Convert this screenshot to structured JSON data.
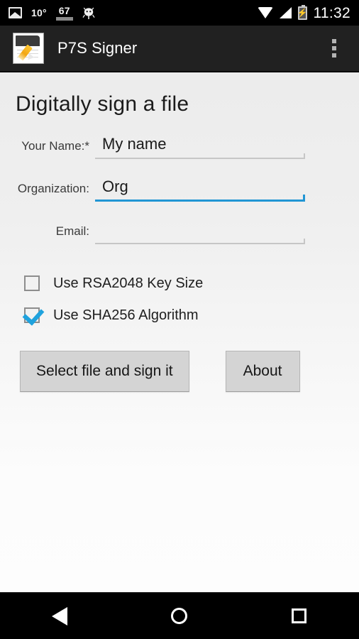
{
  "status_bar": {
    "photo_icon": "photo-icon",
    "temperature": "10°",
    "meter_value": "67",
    "meter_percent": 60,
    "bug_icon": "android-bug-icon",
    "wifi_icon": "wifi-icon",
    "signal_icon": "signal-icon",
    "battery_icon": "battery-charging-icon",
    "time": "11:32"
  },
  "app_bar": {
    "app_icon": "signed-document-icon",
    "title": "P7S Signer",
    "overflow_icon": "overflow-menu-icon"
  },
  "main": {
    "page_title": "Digitally sign a file",
    "fields": [
      {
        "label": "Your Name:*",
        "value": "My name",
        "placeholder": "",
        "focused": false
      },
      {
        "label": "Organization:",
        "value": "Org",
        "placeholder": "",
        "focused": true
      },
      {
        "label": "Email:",
        "value": "",
        "placeholder": "",
        "focused": false
      }
    ],
    "checkboxes": [
      {
        "label": "Use RSA2048 Key Size",
        "checked": false
      },
      {
        "label": "Use SHA256 Algorithm",
        "checked": true
      }
    ],
    "buttons": {
      "sign": "Select file and sign it",
      "about": "About"
    }
  },
  "nav_bar": {
    "back": "back-icon",
    "home": "home-icon",
    "recents": "recents-icon"
  },
  "colors": {
    "accent": "#2196d4",
    "app_bar": "#212121",
    "status_bar": "#000000",
    "content_bg": "#ececec",
    "button_bg": "#d4d4d4"
  }
}
